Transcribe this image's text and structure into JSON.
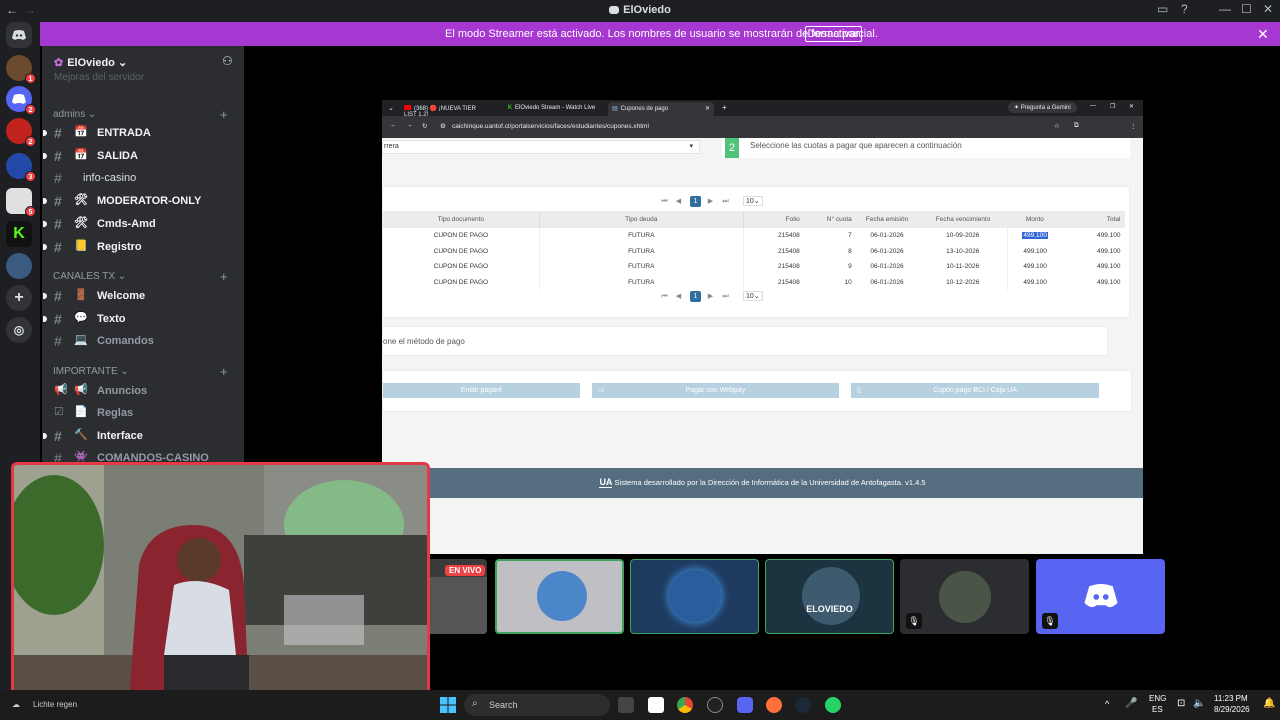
{
  "window": {
    "title": "ElOviedo"
  },
  "streamer_bar": {
    "message": "El modo Streamer está activado. Los nombres de usuario se mostrarán de forma parcial.",
    "button": "Desactivar"
  },
  "guild_badges": [
    "1",
    "2",
    "2",
    "3",
    "5"
  ],
  "server": {
    "name": "ElOviedo",
    "partial_top": "Mejoras del servidor"
  },
  "categories": {
    "admins": "admins",
    "canales_tx": "CANALES TX",
    "importante": "IMPORTANTE"
  },
  "channels": {
    "entrada": "ENTRADA",
    "salida": "SALIDA",
    "info_casino": "info-casino",
    "moderator_only": "MODERATOR-ONLY",
    "cmds_amd": "Cmds-Amd",
    "registro": "Registro",
    "welcome": "Welcome",
    "texto": "Texto",
    "comandos": "Comandos",
    "anuncios": "Anuncios",
    "reglas": "Reglas",
    "interface": "Interface",
    "comandos_casino": "COMANDOS-CASINO"
  },
  "browser": {
    "tabs": [
      "(368) 🔴 ¡NUEVA TIER LIST 1.2!",
      "ElOviedo Stream - Watch Live",
      "Cupones de pago"
    ],
    "gemini": "Pregunta a Gemini",
    "url": "caichinque.uantof.cl/portalservicios/faces/estudiantes/cupones.xhtml"
  },
  "web": {
    "step_number": "2",
    "step_text": "Seleccione las cuotas a pagar que aparecen a continuación",
    "career_select": "rrera",
    "page_current": "1",
    "page_size": "10",
    "columns": [
      "Tipo documento",
      "Tipo deuda",
      "Folio",
      "N° cuota",
      "Fecha emisión",
      "Fecha vencimiento",
      "Monto",
      "Total"
    ],
    "rows": [
      [
        "CUPON DE PAGO",
        "FUTURA",
        "215408",
        "7",
        "06-01-2026",
        "10-09-2026",
        "499.100",
        "499.100"
      ],
      [
        "CUPON DE PAGO",
        "FUTURA",
        "215408",
        "8",
        "06-01-2026",
        "13-10-2026",
        "499.100",
        "499.100"
      ],
      [
        "CUPON DE PAGO",
        "FUTURA",
        "215408",
        "9",
        "06-01-2026",
        "10-11-2026",
        "499.100",
        "499.100"
      ],
      [
        "CUPON DE PAGO",
        "FUTURA",
        "215408",
        "10",
        "06-01-2026",
        "10-12-2026",
        "499.100",
        "499.100"
      ]
    ],
    "method_text": "one el método de pago",
    "buttons": [
      "Emitir pagaré",
      "Pagar con Webpay",
      "Cupón pago BCI / Caja UA"
    ],
    "footer_logo": "UA",
    "footer": "Sistema desarrollado por la Dirección de Informática de la Universidad de Antofagasta. v1.4.5"
  },
  "stream": {
    "live": "EN VIVO",
    "tile_label": "ELOVIEDO"
  },
  "taskbar": {
    "search": "Search",
    "tray_lang": "ENG",
    "tray_region": "ES",
    "time": "11:23 PM",
    "date": "8/29/2026",
    "bottom_left": "Lichte regen"
  },
  "colors": {
    "streamer_bar": "#a637d1",
    "discord_blurple": "#5865f2",
    "ua_blue": "#546e80",
    "live_red": "#ed4245"
  }
}
